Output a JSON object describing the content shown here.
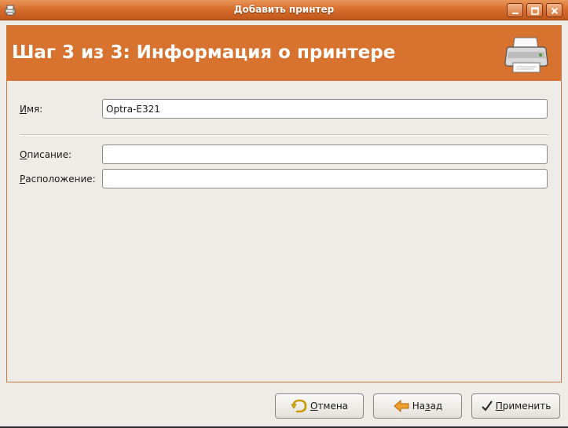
{
  "window": {
    "title": "Добавить принтер",
    "icons": {
      "app": "printer-app-icon",
      "minimize": "minimize-icon",
      "maximize": "maximize-icon",
      "close": "close-icon"
    }
  },
  "banner": {
    "title": "Шаг 3 из 3: Информация о принтере",
    "icon": "printer-icon"
  },
  "form": {
    "name": {
      "label_u": "И",
      "label_rest": "мя:",
      "value": "Optra-E321"
    },
    "description": {
      "label_u": "О",
      "label_rest": "писание:",
      "value": ""
    },
    "location": {
      "label_u": "Р",
      "label_rest": "асположение:",
      "value": ""
    }
  },
  "buttons": {
    "cancel": {
      "label_u": "О",
      "label_rest": "тмена",
      "icon": "undo-arrow-icon"
    },
    "back": {
      "label_pre": "На",
      "label_u": "з",
      "label_rest": "ад",
      "icon": "back-arrow-icon"
    },
    "apply": {
      "label_u": "П",
      "label_rest": "рименить",
      "icon": "checkmark-icon"
    }
  },
  "colors": {
    "accent": "#d7722f",
    "titlebar": "#d86f2e",
    "background": "#efebe7"
  }
}
